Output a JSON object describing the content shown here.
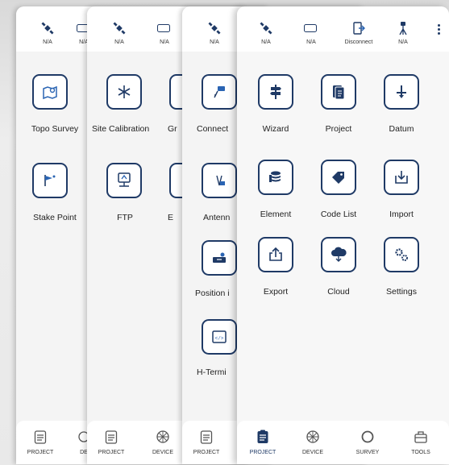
{
  "status": {
    "na": "N/A",
    "disconnect": "Disconnect"
  },
  "panel1": {
    "items": [
      "Topo Survey",
      "Stake Point"
    ]
  },
  "panel2": {
    "items": [
      "Site Calibration",
      "FTP"
    ],
    "partial": [
      "Gr",
      "E"
    ]
  },
  "panel3": {
    "items": [
      "Connect",
      "Antenn",
      "Position i",
      "H-Termi"
    ]
  },
  "panel4": {
    "items": [
      "Wizard",
      "Project",
      "Datum",
      "Element",
      "Code List",
      "Import",
      "Export",
      "Cloud",
      "Settings"
    ]
  },
  "nav": {
    "project": "PROJECT",
    "device": "DEVICE",
    "device_partial": "DE",
    "survey": "SURVEY",
    "tools": "TOOLS"
  },
  "colors": {
    "accent": "#1f3a66",
    "icon_blue": "#2a64b3"
  }
}
